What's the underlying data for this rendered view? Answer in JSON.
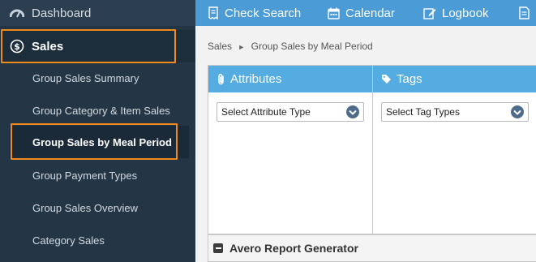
{
  "sidebar": {
    "dashboard_label": "Dashboard",
    "sales_label": "Sales",
    "items": [
      {
        "label": "Group Sales Summary"
      },
      {
        "label": "Group Category & Item Sales"
      },
      {
        "label": "Group Sales by Meal Period"
      },
      {
        "label": "Group Payment Types"
      },
      {
        "label": "Group Sales Overview"
      },
      {
        "label": "Category Sales"
      }
    ],
    "active_item": "Group Sales by Meal Period"
  },
  "topbar": {
    "check_search": "Check Search",
    "calendar": "Calendar",
    "logbook": "Logbook"
  },
  "breadcrumb": {
    "parent": "Sales",
    "separator": "►",
    "current": "Group Sales by Meal Period"
  },
  "attributes": {
    "title": "Attributes",
    "select_value": "Select Attribute Type"
  },
  "tags": {
    "title": "Tags",
    "select_value": "Select Tag Types"
  },
  "report": {
    "title": "Avero Report Generator"
  },
  "colors": {
    "sidebar_bg": "#243646",
    "topbar_bg": "#4a9bd6",
    "panel_header": "#55ace0",
    "highlight": "#ef8a1f"
  }
}
